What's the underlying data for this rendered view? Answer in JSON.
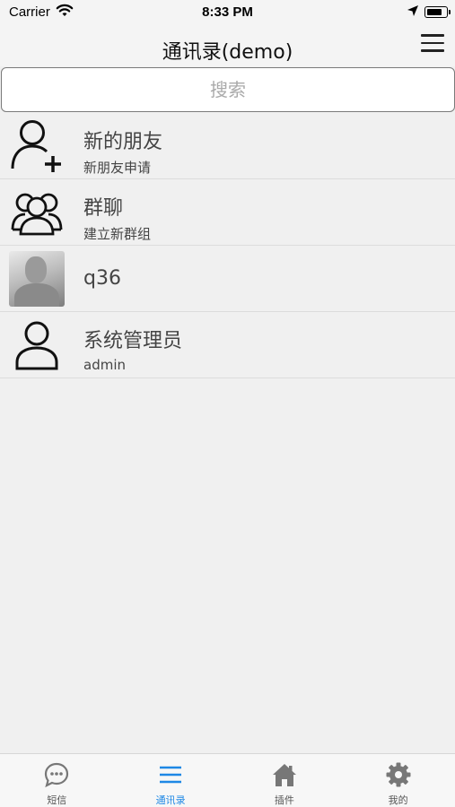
{
  "status_bar": {
    "carrier": "Carrier",
    "time": "8:33 PM"
  },
  "nav": {
    "title": "通讯录(demo)",
    "menu_icon": "hamburger-menu-icon"
  },
  "search": {
    "placeholder": "搜索"
  },
  "contacts": [
    {
      "title": "新的朋友",
      "subtitle": "新朋友申请",
      "icon": "add-friend-icon"
    },
    {
      "title": "群聊",
      "subtitle": "建立新群组",
      "icon": "group-icon"
    },
    {
      "title": "q36",
      "subtitle": "",
      "icon": "avatar-photo"
    },
    {
      "title": "系统管理员",
      "subtitle": "admin",
      "icon": "user-icon"
    }
  ],
  "tabs": [
    {
      "label": "短信",
      "icon": "chat-bubble-icon",
      "active": false
    },
    {
      "label": "通讯录",
      "icon": "list-icon",
      "active": true
    },
    {
      "label": "插件",
      "icon": "home-icon",
      "active": false
    },
    {
      "label": "我的",
      "icon": "gear-icon",
      "active": false
    }
  ],
  "colors": {
    "active_tab": "#1e88e5",
    "inactive_tab": "#777777",
    "background": "#f0f0f0"
  }
}
